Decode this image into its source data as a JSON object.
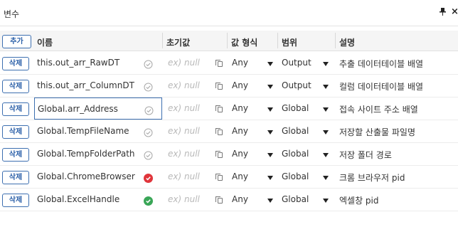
{
  "panel": {
    "title": "변수",
    "pin_icon": "pin-icon",
    "close_label": "×"
  },
  "toolbar": {
    "add_label": "추가"
  },
  "columns": {
    "name": "이름",
    "initial": "초기값",
    "type": "값 형식",
    "scope": "범위",
    "desc": "설명"
  },
  "rows": [
    {
      "delete_label": "삭제",
      "name": "this.out_arr_RawDT",
      "status": "unchecked",
      "initial_placeholder": "ex) null",
      "type": "Any",
      "scope": "Output",
      "desc": "추출 데이터테이블 배열"
    },
    {
      "delete_label": "삭제",
      "name": "this.out_arr_ColumnDT",
      "status": "unchecked",
      "initial_placeholder": "ex) null",
      "type": "Any",
      "scope": "Output",
      "desc": "컬럼 데이터테이블 배열"
    },
    {
      "delete_label": "삭제",
      "name": "Global.arr_Address",
      "status": "unchecked",
      "initial_placeholder": "ex) null",
      "type": "Any",
      "scope": "Global",
      "desc": "접속 사이트 주소 배열"
    },
    {
      "delete_label": "삭제",
      "name": "Global.TempFileName",
      "status": "unchecked",
      "initial_placeholder": "ex) null",
      "type": "Any",
      "scope": "Global",
      "desc": "저장할 산출물 파일명"
    },
    {
      "delete_label": "삭제",
      "name": "Global.TempFolderPath",
      "status": "unchecked",
      "initial_placeholder": "ex) null",
      "type": "Any",
      "scope": "Global",
      "desc": "저장 폴더 경로"
    },
    {
      "delete_label": "삭제",
      "name": "Global.ChromeBrowser",
      "status": "error",
      "initial_placeholder": "ex) null",
      "type": "Any",
      "scope": "Global",
      "desc": "크롬 브라우저 pid"
    },
    {
      "delete_label": "삭제",
      "name": "Global.ExcelHandle",
      "status": "ok",
      "initial_placeholder": "ex) null",
      "type": "Any",
      "scope": "Global",
      "desc": "엑셀창 pid"
    }
  ],
  "colors": {
    "accent": "#3d6fb0",
    "error": "#e0353b",
    "ok": "#3aa657",
    "neutral": "#a8a8a8"
  }
}
